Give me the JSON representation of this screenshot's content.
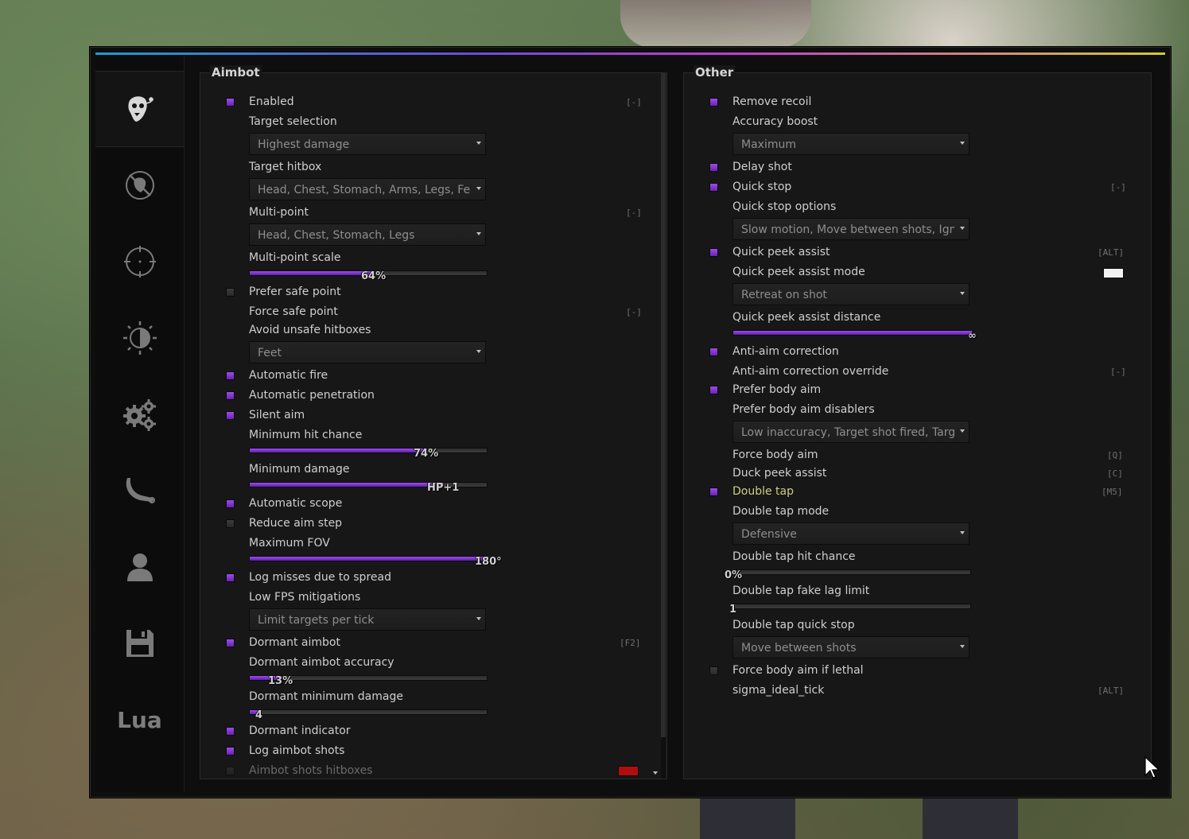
{
  "colors": {
    "accent": "#7b2fd1",
    "swatch_white": "#f2f2f2",
    "swatch_red": "#b00e0e",
    "label_gold": "#cdcd85"
  },
  "sidebar": {
    "tabs": [
      {
        "icon": "ragebot-mask-icon",
        "active": true
      },
      {
        "icon": "anti-aim-icon",
        "active": false
      },
      {
        "icon": "crosshair-icon",
        "active": false
      },
      {
        "icon": "visuals-contrast-icon",
        "active": false
      },
      {
        "icon": "gears-icon",
        "active": false
      },
      {
        "icon": "knife-icon",
        "active": false
      },
      {
        "icon": "player-icon",
        "active": false
      },
      {
        "icon": "floppy-disk-icon",
        "active": false
      },
      {
        "label": "Lua",
        "active": false
      }
    ]
  },
  "aimbot": {
    "title": "Aimbot",
    "enabled": {
      "label": "Enabled",
      "key": "[-]",
      "checked": true
    },
    "target_selection": {
      "label": "Target selection",
      "value": "Highest damage"
    },
    "target_hitbox": {
      "label": "Target hitbox",
      "value": "Head, Chest, Stomach, Arms, Legs, Feet"
    },
    "multi_point": {
      "label": "Multi-point",
      "key": "[-]",
      "value": "Head, Chest, Stomach, Legs"
    },
    "multi_point_scale": {
      "label": "Multi-point scale",
      "display": "64%",
      "fraction": 0.52
    },
    "prefer_safe_point": {
      "label": "Prefer safe point",
      "checked": false
    },
    "force_safe_point": {
      "label": "Force safe point",
      "key": "[-]"
    },
    "avoid_unsafe": {
      "label": "Avoid unsafe hitboxes",
      "value": "Feet"
    },
    "automatic_fire": {
      "label": "Automatic fire",
      "checked": true
    },
    "automatic_penetration": {
      "label": "Automatic penetration",
      "checked": true
    },
    "silent_aim": {
      "label": "Silent aim",
      "checked": true
    },
    "min_hit_chance": {
      "label": "Minimum hit chance",
      "display": "74%",
      "fraction": 0.74
    },
    "min_damage": {
      "label": "Minimum damage",
      "display": "HP+1",
      "fraction": 0.81
    },
    "automatic_scope": {
      "label": "Automatic scope",
      "checked": true
    },
    "reduce_aim_step": {
      "label": "Reduce aim step",
      "checked": false
    },
    "max_fov": {
      "label": "Maximum FOV",
      "display": "180°",
      "fraction": 1.0
    },
    "log_misses": {
      "label": "Log misses due to spread",
      "checked": true
    },
    "low_fps": {
      "label": "Low FPS mitigations",
      "value": "Limit targets per tick"
    },
    "dormant_aimbot": {
      "label": "Dormant aimbot",
      "key": "[F2]",
      "checked": true
    },
    "dormant_accuracy": {
      "label": "Dormant aimbot accuracy",
      "display": "13%",
      "fraction": 0.13
    },
    "dormant_min_damage": {
      "label": "Dormant minimum damage",
      "display": "4",
      "fraction": 0.04
    },
    "dormant_indicator": {
      "label": "Dormant indicator",
      "checked": true
    },
    "log_aimbot_shots": {
      "label": "Log aimbot shots",
      "checked": true
    },
    "aimbot_shots_hitboxes": {
      "label": "Aimbot shots hitboxes",
      "checked": false
    }
  },
  "other": {
    "title": "Other",
    "remove_recoil": {
      "label": "Remove recoil",
      "checked": true
    },
    "accuracy_boost": {
      "label": "Accuracy boost",
      "value": "Maximum"
    },
    "delay_shot": {
      "label": "Delay shot",
      "checked": true
    },
    "quick_stop": {
      "label": "Quick stop",
      "key": "[-]",
      "checked": true
    },
    "quick_stop_options": {
      "label": "Quick stop options",
      "value": "Slow motion, Move between shots, Ignore molotov"
    },
    "quick_peek_assist": {
      "label": "Quick peek assist",
      "key": "[ALT]",
      "checked": true
    },
    "quick_peek_mode": {
      "label": "Quick peek assist mode",
      "value": "Retreat on shot"
    },
    "quick_peek_distance": {
      "label": "Quick peek assist distance",
      "display": "∞",
      "fraction": 1.0
    },
    "anti_aim_correction": {
      "label": "Anti-aim correction",
      "checked": true
    },
    "anti_aim_override": {
      "label": "Anti-aim correction override",
      "key": "[-]"
    },
    "prefer_body_aim": {
      "label": "Prefer body aim",
      "checked": true
    },
    "prefer_body_aim_disablers": {
      "label": "Prefer body aim disablers",
      "value": "Low inaccuracy, Target shot fired, Target resolved"
    },
    "force_body_aim": {
      "label": "Force body aim",
      "key": "[Q]"
    },
    "duck_peek_assist": {
      "label": "Duck peek assist",
      "key": "[C]"
    },
    "double_tap": {
      "label": "Double tap",
      "key": "[M5]",
      "checked": true
    },
    "double_tap_mode": {
      "label": "Double tap mode",
      "value": "Defensive"
    },
    "double_tap_hit_chance": {
      "label": "Double tap hit chance",
      "display": "0%",
      "fraction": 0.0
    },
    "double_tap_fake_lag": {
      "label": "Double tap fake lag limit",
      "display": "1",
      "fraction": 0.0
    },
    "double_tap_quick_stop": {
      "label": "Double tap quick stop",
      "value": "Move between shots"
    },
    "force_body_aim_lethal": {
      "label": "Force body aim if lethal",
      "checked": false
    },
    "sigma_ideal_tick": {
      "label": "sigma_ideal_tick",
      "key": "[ALT]"
    }
  }
}
